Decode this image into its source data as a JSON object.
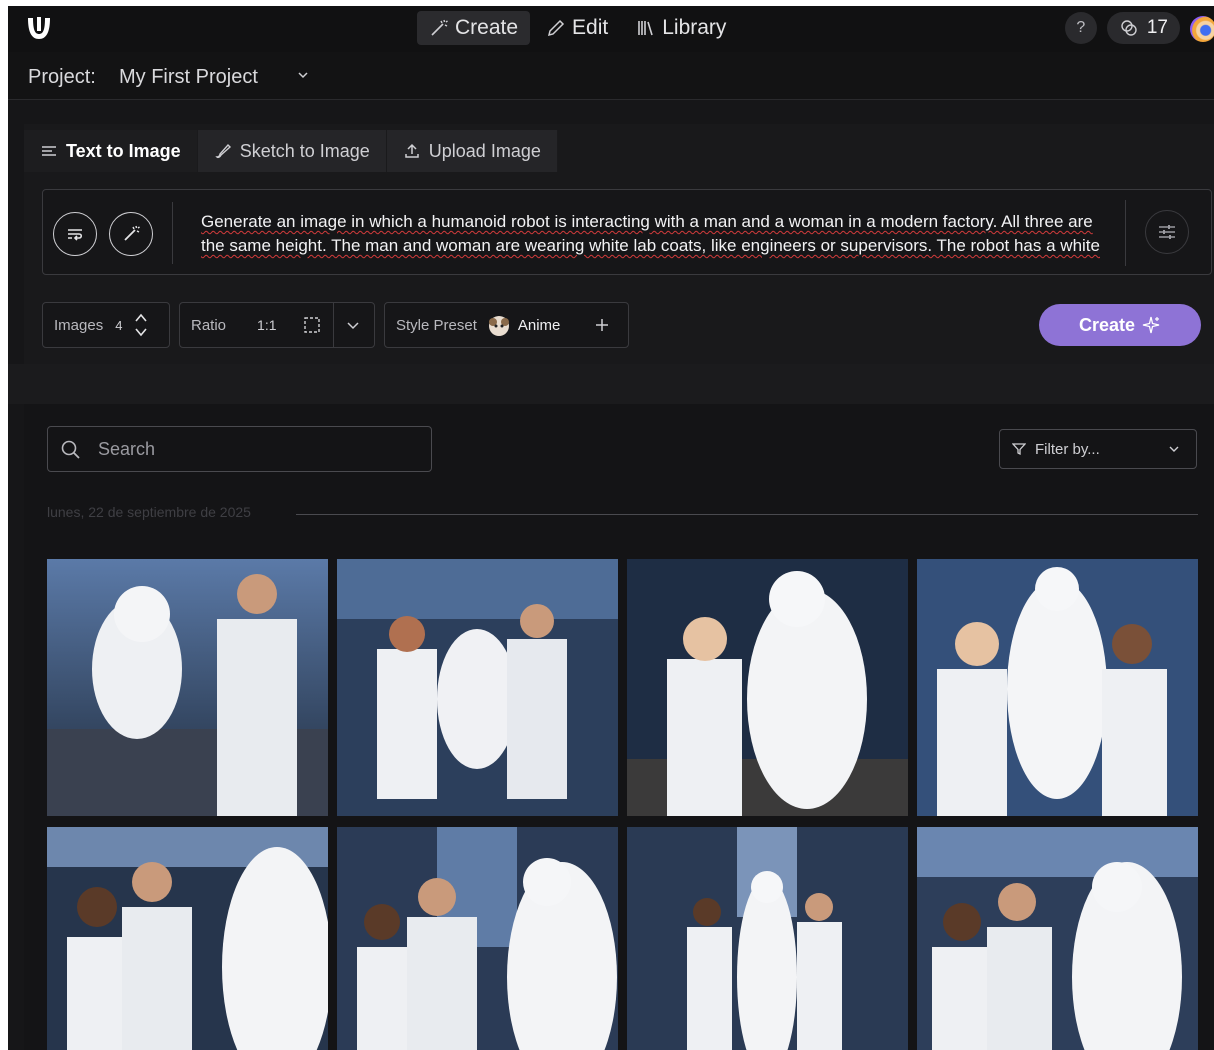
{
  "nav": {
    "create": "Create",
    "edit": "Edit",
    "library": "Library"
  },
  "header": {
    "help": "?",
    "credits": "17"
  },
  "project": {
    "label": "Project:",
    "name": "My First Project"
  },
  "tabs": [
    {
      "label": "Text to Image"
    },
    {
      "label": "Sketch to Image"
    },
    {
      "label": "Upload Image"
    }
  ],
  "prompt": {
    "text": "Generate an image in which a humanoid robot is interacting with a man and a woman in a modern factory. All three are the same height. The man and woman are wearing white lab coats, like engineers or supervisors. The robot has a white and black body"
  },
  "controls": {
    "images_label": "Images",
    "images_value": "4",
    "ratio_label": "Ratio",
    "ratio_value": "1:1",
    "style_label": "Style Preset",
    "style_value": "Anime",
    "create_label": "Create"
  },
  "gallery": {
    "search_placeholder": "Search",
    "filter_label": "Filter by...",
    "date_label": "lunes, 22 de septiembre de 2025"
  },
  "colors": {
    "accent": "#8e73d6",
    "background": "#161618",
    "topbar": "#111112"
  }
}
